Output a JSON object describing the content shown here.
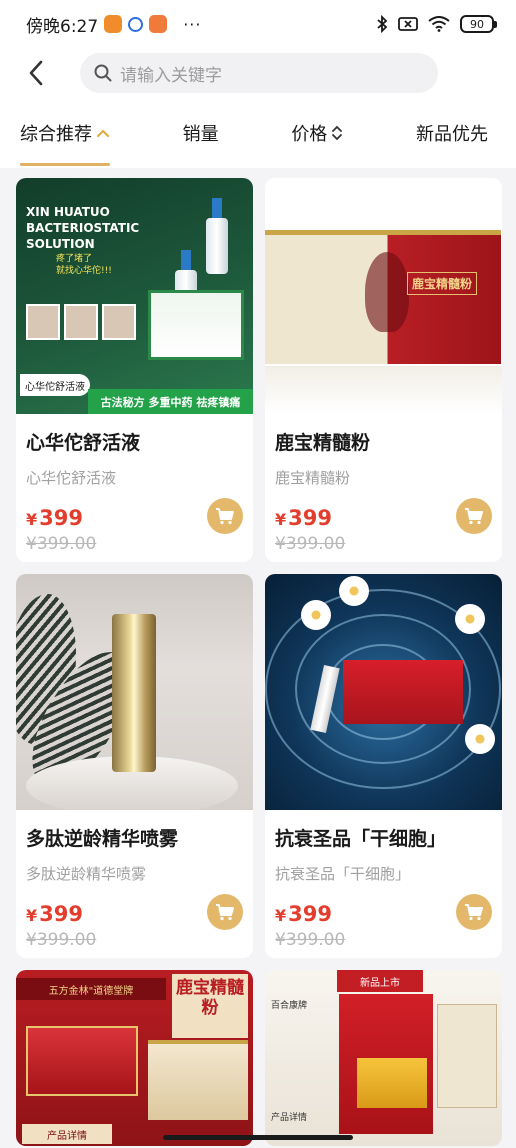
{
  "status_bar": {
    "time": "傍晚6:27",
    "battery": "90"
  },
  "search": {
    "placeholder": "请输入关键字"
  },
  "sort_tabs": [
    {
      "label": "综合推荐"
    },
    {
      "label": "销量"
    },
    {
      "label": "价格"
    },
    {
      "label": "新品优先"
    }
  ],
  "products": [
    {
      "title": "心华佗舒活液",
      "subtitle": "心华佗舒活液",
      "price": "399",
      "original_price": "¥399.00",
      "currency": "¥",
      "image_text": {
        "headline": "XIN HUATUO BACTERIOSTATIC SOLUTION",
        "tagline_1": "疼了堵了",
        "tagline_2": "就找心华佗!!!",
        "label": "心华佗舒活液",
        "banner": "古法秘方 多重中药 祛疼镇痛"
      }
    },
    {
      "title": "鹿宝精髓粉",
      "subtitle": "鹿宝精髓粉",
      "price": "399",
      "original_price": "¥399.00",
      "currency": "¥",
      "image_text": {
        "box_title": "鹿宝精髓粉"
      }
    },
    {
      "title": "多肽逆龄精华喷雾",
      "subtitle": "多肽逆龄精华喷雾",
      "price": "399",
      "original_price": "¥399.00",
      "currency": "¥"
    },
    {
      "title": "抗衰圣品「干细胞」",
      "subtitle": "抗衰圣品「干细胞」",
      "price": "399",
      "original_price": "¥399.00",
      "currency": "¥"
    },
    {
      "image_text": {
        "banner": "五方金林\"道德堂牌",
        "big_title": "鹿宝精髓粉",
        "footer": "产品详情"
      }
    },
    {
      "image_text": {
        "tag": "新品上市",
        "line": "百合康牌",
        "footer": "产品详情"
      }
    }
  ],
  "colors": {
    "accent": "#e0b163",
    "price": "#e33d2d",
    "cart": "#e3b86a"
  }
}
